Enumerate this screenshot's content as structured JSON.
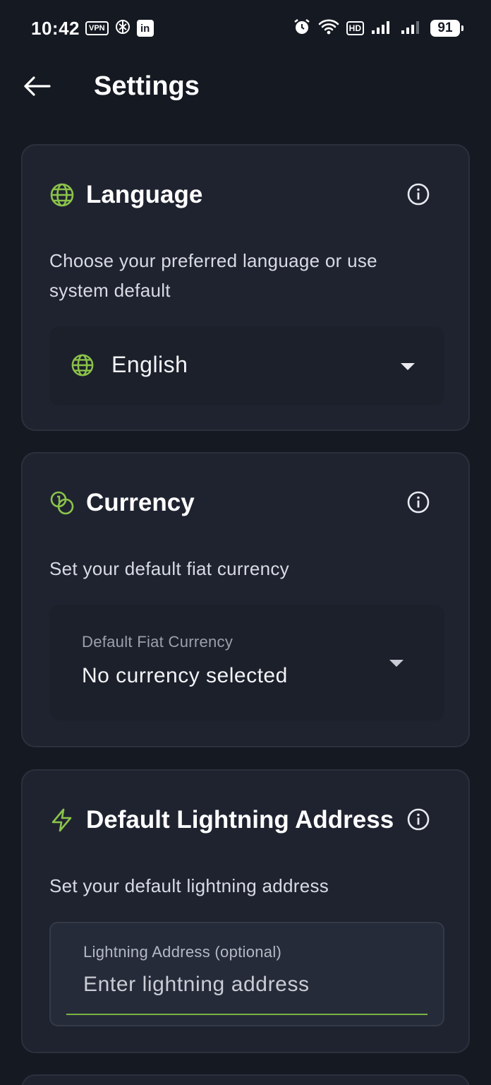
{
  "status_bar": {
    "time": "10:42",
    "vpn_badge": "VPN",
    "linkedin_badge": "in",
    "hd_badge": "HD",
    "battery": "91"
  },
  "app_bar": {
    "title": "Settings"
  },
  "language_card": {
    "title": "Language",
    "description": "Choose your preferred language or use system default",
    "selected_language": "English"
  },
  "currency_card": {
    "title": "Currency",
    "description": "Set your default fiat currency",
    "field_label": "Default Fiat Currency",
    "field_value": "No currency selected"
  },
  "lightning_card": {
    "title": "Default Lightning Address",
    "description": "Set your default lightning address",
    "field_label": "Lightning Address (optional)",
    "field_placeholder": "Enter lightning address"
  },
  "colors": {
    "background": "#151922",
    "card": "#1f2330",
    "accent_green": "#8bc34a",
    "text": "#ffffff"
  },
  "icons": {
    "back": "arrow-left-icon",
    "language": "globe-icon",
    "currency": "coins-icon",
    "lightning": "lightning-bolt-icon",
    "info": "info-icon",
    "dropdown": "caret-down-icon"
  }
}
